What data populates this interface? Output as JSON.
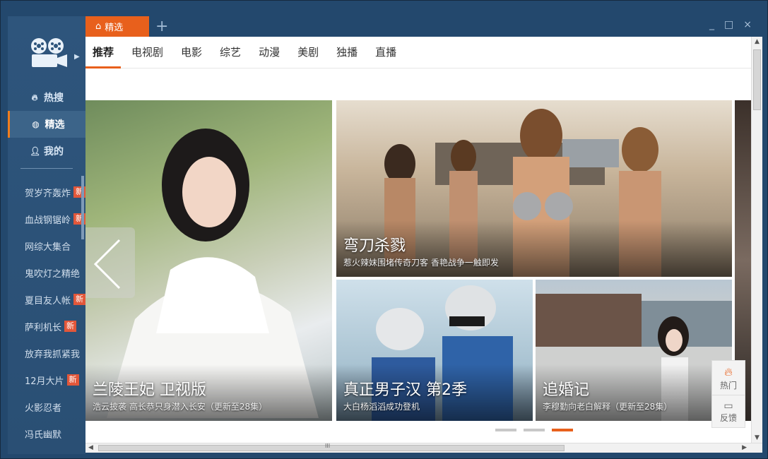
{
  "window": {
    "tab_label": "精选",
    "add_tab": "+",
    "minimize": "_",
    "maximize": "□",
    "close": "×"
  },
  "rail": {
    "nav": [
      {
        "label": "热搜",
        "icon": "flame-icon"
      },
      {
        "label": "精选",
        "icon": "compass-icon"
      },
      {
        "label": "我的",
        "icon": "user-icon"
      }
    ],
    "list": [
      {
        "label": "贺岁齐轰炸",
        "badge": "新"
      },
      {
        "label": "血战钢锯岭",
        "badge": "新"
      },
      {
        "label": "网综大集合",
        "badge": ""
      },
      {
        "label": "鬼吹灯之精绝",
        "badge": ""
      },
      {
        "label": "夏目友人帐",
        "badge": "新"
      },
      {
        "label": "萨利机长",
        "badge": "新"
      },
      {
        "label": "放弃我抓紧我",
        "badge": ""
      },
      {
        "label": "12月大片",
        "badge": "新"
      },
      {
        "label": "火影忍者",
        "badge": ""
      },
      {
        "label": "冯氏幽默",
        "badge": ""
      }
    ]
  },
  "subnav": [
    "推荐",
    "电视剧",
    "电影",
    "综艺",
    "动漫",
    "美剧",
    "独播",
    "直播"
  ],
  "tiles": [
    {
      "title": "兰陵王妃 卫视版",
      "subtitle": "浩云披袭 高长恭只身潜入长安（更新至28集）"
    },
    {
      "title": "弯刀杀戮",
      "subtitle": "惹火辣妹围堵传奇刀客 香艳战争一触即发"
    },
    {
      "title": "真正男子汉 第2季",
      "subtitle": "大白杨滔滔成功登机"
    },
    {
      "title": "追婚记",
      "subtitle": "李穆勤向老白解释（更新至28集）"
    }
  ],
  "float": {
    "hot": "热门",
    "feedback": "反馈"
  },
  "scroll_mark": "III"
}
